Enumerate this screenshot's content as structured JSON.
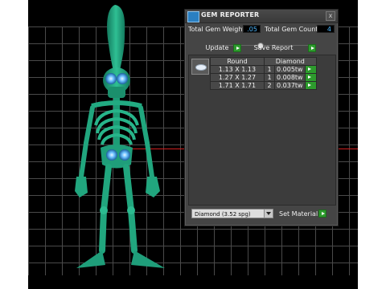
{
  "panel": {
    "title": "GEM REPORTER",
    "close_label": "x",
    "total_weight_label": "Total Gem Weight",
    "total_weight_value": ".05",
    "total_count_label": "Total Gem Count",
    "total_count_value": "4",
    "update_label": "Update",
    "save_report_label": "Save Report",
    "table": {
      "headers": [
        "Round",
        "Diamond"
      ],
      "rows": [
        {
          "size": "1.13 X 1.13",
          "count": "1",
          "weight": "0.005tw"
        },
        {
          "size": "1.27 X 1.27",
          "count": "1",
          "weight": "0.008tw"
        },
        {
          "size": "1.71 X 1.71",
          "count": "2",
          "weight": "0.037tw"
        }
      ]
    },
    "material_select_value": "Diamond     (3.52 spg)",
    "set_material_label": "Set Material"
  },
  "colors": {
    "skeleton": "#1f9e7a",
    "eye_glow": "#5ab4ff",
    "go_button": "#2d9b2d",
    "value_text": "#4fb8ff"
  }
}
